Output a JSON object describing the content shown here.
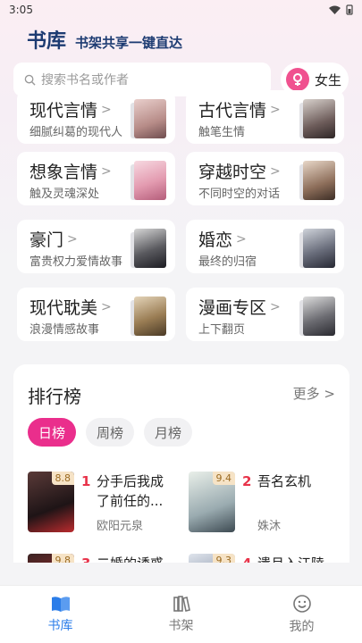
{
  "status": {
    "time": "3:05"
  },
  "header": {
    "title": "书库",
    "slogan": "书架共享一键直达"
  },
  "search": {
    "placeholder": "搜索书名或作者"
  },
  "gender": {
    "label": "女生"
  },
  "categories": [
    {
      "name": "现代言情",
      "desc": "细腻纠葛的现代人"
    },
    {
      "name": "古代言情",
      "desc": "触笔生情"
    },
    {
      "name": "想象言情",
      "desc": "触及灵魂深处"
    },
    {
      "name": "穿越时空",
      "desc": "不同时空的对话"
    },
    {
      "name": "豪门",
      "desc": "富贵权力爱情故事"
    },
    {
      "name": "婚恋",
      "desc": "最终的归宿"
    },
    {
      "name": "现代耽美",
      "desc": "浪漫情感故事"
    },
    {
      "name": "漫画专区",
      "desc": "上下翻页"
    }
  ],
  "ranking": {
    "title": "排行榜",
    "more": "更多",
    "tabs": [
      "日榜",
      "周榜",
      "月榜"
    ],
    "books": [
      {
        "rank": "1",
        "score": "8.8",
        "name": "分手后我成了前任的...",
        "author": "欧阳元泉"
      },
      {
        "rank": "2",
        "score": "9.4",
        "name": "吾名玄机",
        "author": "姝沐"
      },
      {
        "rank": "3",
        "score": "9.8",
        "name": "二婚的诱惑",
        "author": ""
      },
      {
        "rank": "4",
        "score": "9.3",
        "name": "遗月入江陵",
        "author": ""
      }
    ]
  },
  "nav": {
    "items": [
      "书库",
      "书架",
      "我的"
    ]
  },
  "colors": {
    "accent": "#ea2e8c",
    "brand": "#1d3b72",
    "nav_active": "#2b7de9"
  }
}
